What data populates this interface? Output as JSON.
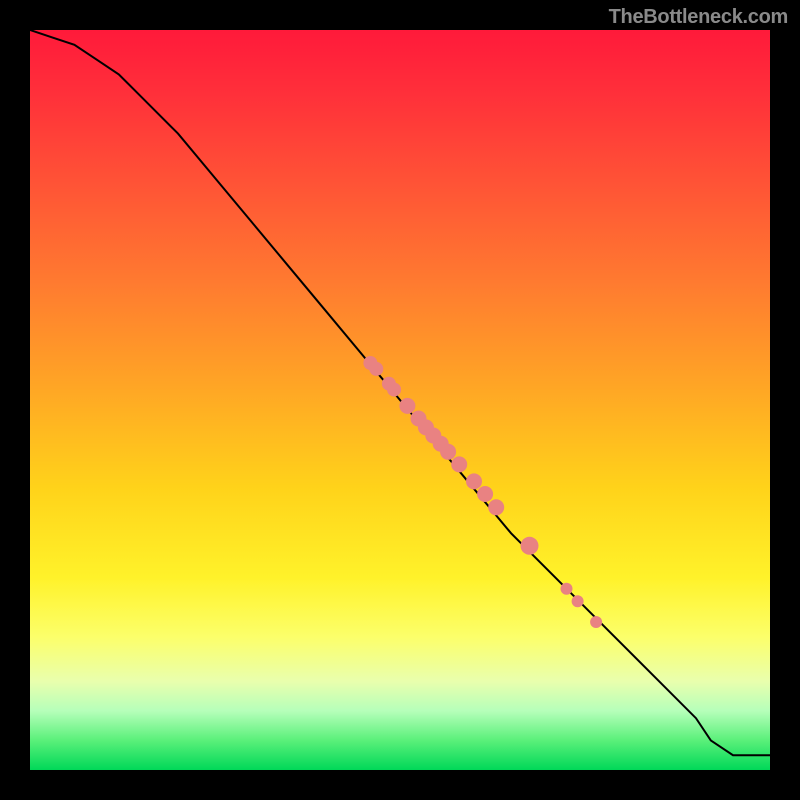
{
  "attribution": "TheBottleneck.com",
  "chart_data": {
    "type": "line",
    "title": "",
    "xlabel": "",
    "ylabel": "",
    "xlim": [
      0,
      100
    ],
    "ylim": [
      0,
      100
    ],
    "grid": false,
    "legend": false,
    "series": [
      {
        "name": "bottleneck-curve",
        "x": [
          0,
          3,
          6,
          9,
          12,
          15,
          20,
          25,
          30,
          35,
          40,
          45,
          50,
          55,
          60,
          65,
          70,
          75,
          80,
          85,
          90,
          92,
          95,
          100
        ],
        "y": [
          100,
          99,
          98,
          96,
          94,
          91,
          86,
          80,
          74,
          68,
          62,
          56,
          50,
          44,
          38,
          32,
          27,
          22,
          17,
          12,
          7,
          4,
          2,
          2
        ]
      }
    ],
    "points": {
      "name": "highlighted-points",
      "x": [
        46.0,
        46.8,
        48.5,
        49.2,
        51.0,
        52.5,
        53.5,
        54.5,
        55.5,
        56.5,
        58.0,
        60.0,
        61.5,
        63.0,
        67.5,
        72.5,
        74.0,
        76.5
      ],
      "y": [
        55.0,
        54.2,
        52.2,
        51.4,
        49.2,
        47.5,
        46.3,
        45.2,
        44.1,
        43.0,
        41.3,
        39.0,
        37.3,
        35.5,
        30.3,
        24.5,
        22.8,
        20.0
      ],
      "r": [
        7,
        7,
        7,
        7,
        8,
        8,
        8,
        8,
        8,
        8,
        8,
        8,
        8,
        8,
        9,
        6,
        6,
        6
      ]
    },
    "colors": {
      "curve": "#000000",
      "points": "#e98282",
      "gradient_top": "#ff1a3a",
      "gradient_bottom": "#00d858"
    }
  }
}
